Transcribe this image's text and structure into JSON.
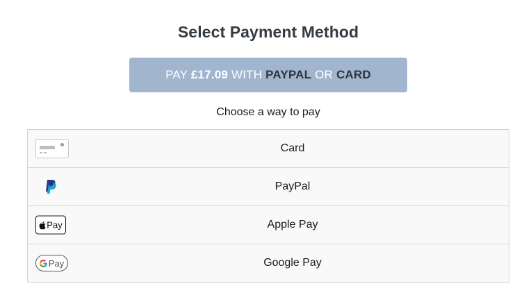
{
  "header": {
    "title": "Select Payment Method"
  },
  "pay_button": {
    "part1": "PAY ",
    "amount": "£17.09",
    "part2": " WITH ",
    "method1": "PAYPAL",
    "part3": " OR ",
    "method2": "CARD"
  },
  "subtitle": "Choose a way to pay",
  "methods": [
    {
      "label": "Card",
      "icon": "credit-card-icon"
    },
    {
      "label": "PayPal",
      "icon": "paypal-icon"
    },
    {
      "label": "Apple Pay",
      "icon": "apple-pay-icon",
      "badge_text": "Pay"
    },
    {
      "label": "Google Pay",
      "icon": "google-pay-icon",
      "badge_text": "Pay"
    }
  ],
  "colors": {
    "title": "#353b42",
    "button_bg": "#a2b5cf",
    "paypal_dark": "#253b80",
    "paypal_light": "#179bd7"
  }
}
